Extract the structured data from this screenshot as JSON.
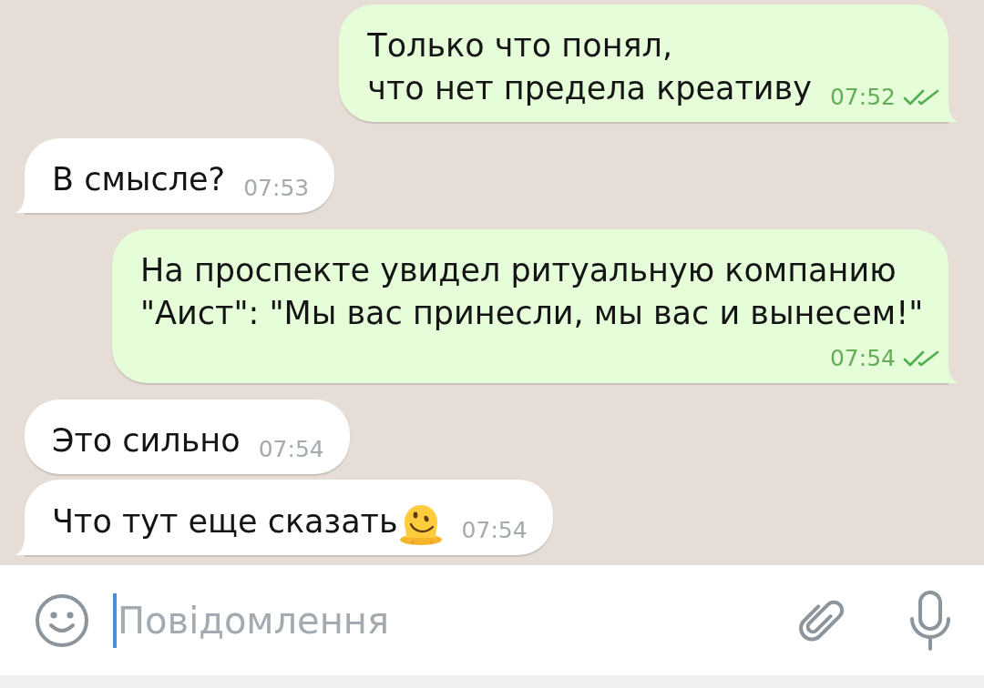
{
  "messages": [
    {
      "kind": "outgoing",
      "tail": true,
      "text": "Только что понял,\nчто нет предела креативу",
      "time": "07:52",
      "read": true
    },
    {
      "kind": "incoming",
      "tail": true,
      "text": "В смысле?",
      "time": "07:53"
    },
    {
      "kind": "outgoing",
      "tail": true,
      "text": "На проспекте увидел ритуальную компанию \"Аист\": \"Мы вас принесли, мы вас и вынесем!\"",
      "time": "07:54",
      "read": true
    },
    {
      "kind": "incoming",
      "tail": false,
      "text": "Это сильно",
      "time": "07:54"
    },
    {
      "kind": "incoming",
      "tail": true,
      "text": "Что тут еще сказать",
      "emoji": true,
      "time": "07:54"
    }
  ],
  "composer": {
    "placeholder": "Повідомлення",
    "focused": true
  }
}
